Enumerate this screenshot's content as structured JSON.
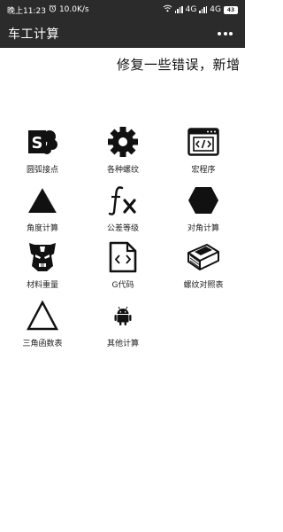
{
  "status_bar": {
    "time": "晚上11:23",
    "speed": "10.0K/s",
    "network1": "4G",
    "network2": "4G",
    "battery": "43"
  },
  "app_bar": {
    "title": "车工计算",
    "menu_icon": "more-vert-icon"
  },
  "marquee": {
    "text": "修复一些错误，新增"
  },
  "grid": [
    {
      "label": "圆弧接点",
      "icon": "sharepoint-s-icon"
    },
    {
      "label": "各种螺纹",
      "icon": "gear-icon"
    },
    {
      "label": "宏程序",
      "icon": "code-window-icon"
    },
    {
      "label": "角度计算",
      "icon": "triangle-icon"
    },
    {
      "label": "公差等级",
      "icon": "function-fx-icon"
    },
    {
      "label": "对角计算",
      "icon": "hexagon-icon"
    },
    {
      "label": "材料重量",
      "icon": "transformer-mask-icon"
    },
    {
      "label": "G代码",
      "icon": "code-file-icon"
    },
    {
      "label": "螺纹对照表",
      "icon": "book-icon"
    },
    {
      "label": "三角函数表",
      "icon": "triangle-outline-icon"
    },
    {
      "label": "其他计算",
      "icon": "android-icon"
    }
  ]
}
